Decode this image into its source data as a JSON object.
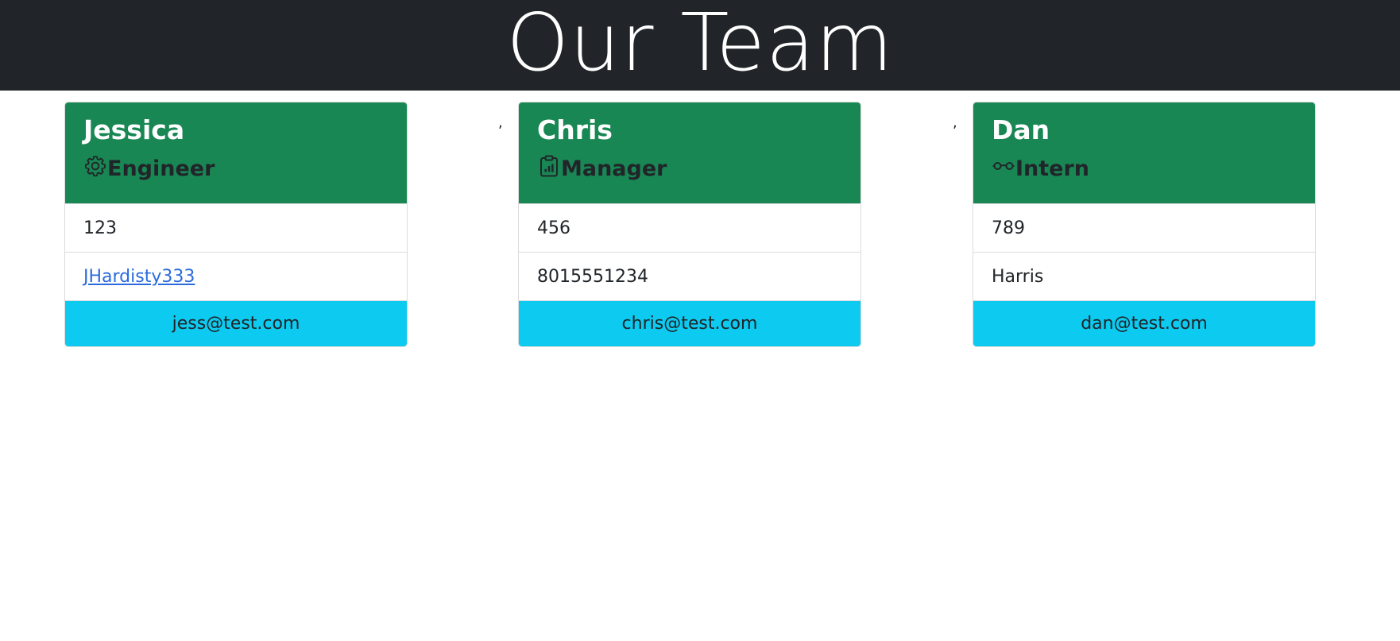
{
  "page": {
    "title": "Our Team",
    "separator": ","
  },
  "colors": {
    "header_bg": "#212529",
    "card_header_bg": "#198754",
    "footer_bg": "#0dcaf0",
    "link": "#2b6bdd"
  },
  "team": [
    {
      "name": "Jessica",
      "role": "Engineer",
      "role_icon": "gear-icon",
      "id": "123",
      "detail": "JHardisty333",
      "email": "jess@test.com"
    },
    {
      "name": "Chris",
      "role": "Manager",
      "role_icon": "clipboard-chart-icon",
      "id": "456",
      "detail": "8015551234",
      "email": "chris@test.com"
    },
    {
      "name": "Dan",
      "role": "Intern",
      "role_icon": "glasses-icon",
      "id": "789",
      "detail": "Harris",
      "email": "dan@test.com"
    }
  ]
}
